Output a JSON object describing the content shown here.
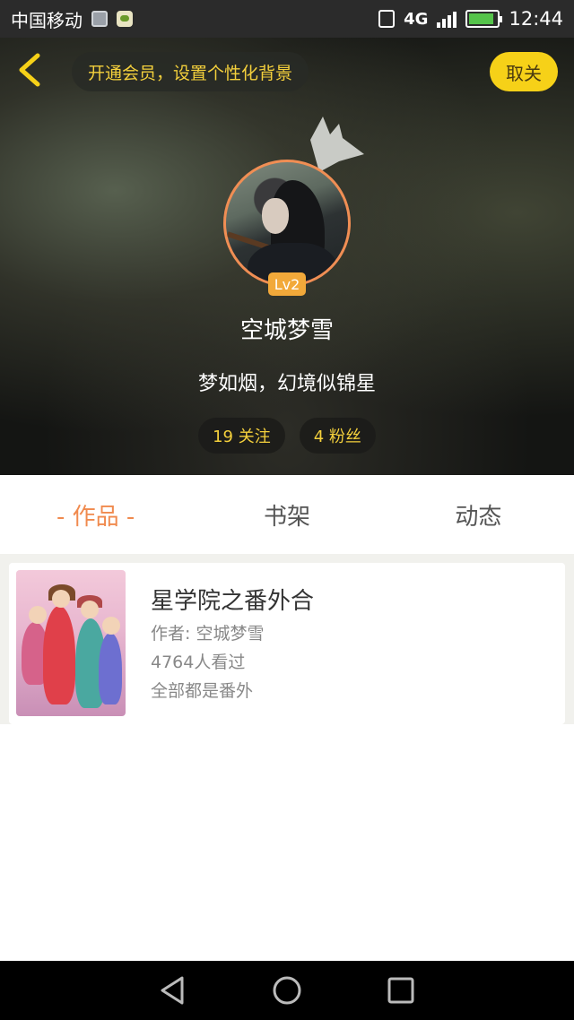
{
  "status_bar": {
    "carrier": "中国移动",
    "network": "4G",
    "network_small": "4G",
    "time": "12:44",
    "icons": [
      "gallery-notification-icon",
      "chat-notification-icon",
      "vibrate-icon",
      "signal-icon",
      "battery-icon"
    ],
    "battery_level": 0.9
  },
  "header": {
    "vip_banner": "开通会员，设置个性化背景",
    "unfollow_label": "取关",
    "back_icon": "chevron-left-icon",
    "accent_color": "#f6d118"
  },
  "profile": {
    "username": "空城梦雪",
    "level": "Lv2",
    "bio": "梦如烟，幻境似锦星",
    "following": "19 关注",
    "followers": "4 粉丝",
    "avatar_border_color": "#f08e54"
  },
  "tabs": [
    {
      "label": "- 作品 -",
      "active": true
    },
    {
      "label": "书架",
      "active": false
    },
    {
      "label": "动态",
      "active": false
    }
  ],
  "works": [
    {
      "title": "星学院之番外合",
      "author": "作者: 空城梦雪",
      "views": "4764人看过",
      "description": "全部都是番外"
    }
  ],
  "nav_bar": {
    "buttons": [
      "back-triangle-icon",
      "home-circle-icon",
      "recents-square-icon"
    ]
  }
}
